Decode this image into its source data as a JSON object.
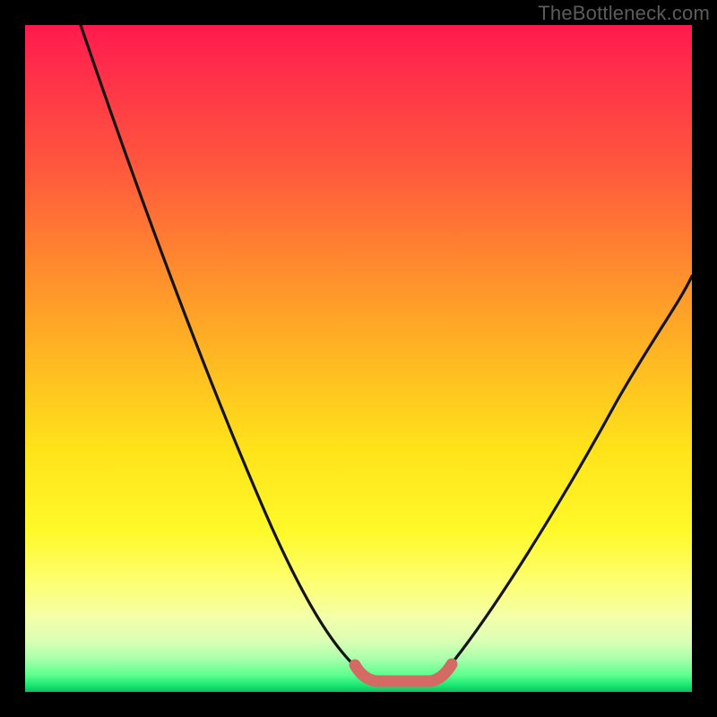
{
  "watermark": {
    "text": "TheBottleneck.com"
  },
  "colors": {
    "background": "#000000",
    "curve_stroke": "#141414",
    "highlight_stroke": "#d46a63",
    "gradient_stops": [
      "#ff1a4d",
      "#ff5a3c",
      "#ffb822",
      "#fff92a",
      "#5cff8e",
      "#0fbf5e"
    ]
  },
  "chart_data": {
    "type": "line",
    "title": "",
    "xlabel": "",
    "ylabel": "",
    "xlim": [
      0,
      100
    ],
    "ylim": [
      0,
      100
    ],
    "grid": false,
    "legend": false,
    "note": "Background colour encodes y-value (red=high, green=low). Values are percentage estimates read from vertical gradient position.",
    "series": [
      {
        "name": "left-falling-curve",
        "x": [
          8,
          12,
          16,
          20,
          24,
          28,
          32,
          36,
          40,
          44,
          47,
          50,
          52
        ],
        "values": [
          100,
          90,
          80,
          70,
          60,
          50,
          40,
          30,
          20,
          11,
          6,
          3,
          2
        ]
      },
      {
        "name": "right-rising-curve",
        "x": [
          62,
          65,
          68,
          72,
          76,
          80,
          84,
          88,
          92,
          96,
          100
        ],
        "values": [
          2,
          4,
          8,
          14,
          21,
          29,
          37,
          45,
          52,
          58,
          63
        ]
      },
      {
        "name": "bottom-highlight-band",
        "x": [
          50,
          52,
          54,
          56,
          58,
          60,
          62,
          64
        ],
        "values": [
          3,
          2,
          1.5,
          1.5,
          1.5,
          1.5,
          2,
          3
        ]
      }
    ]
  }
}
